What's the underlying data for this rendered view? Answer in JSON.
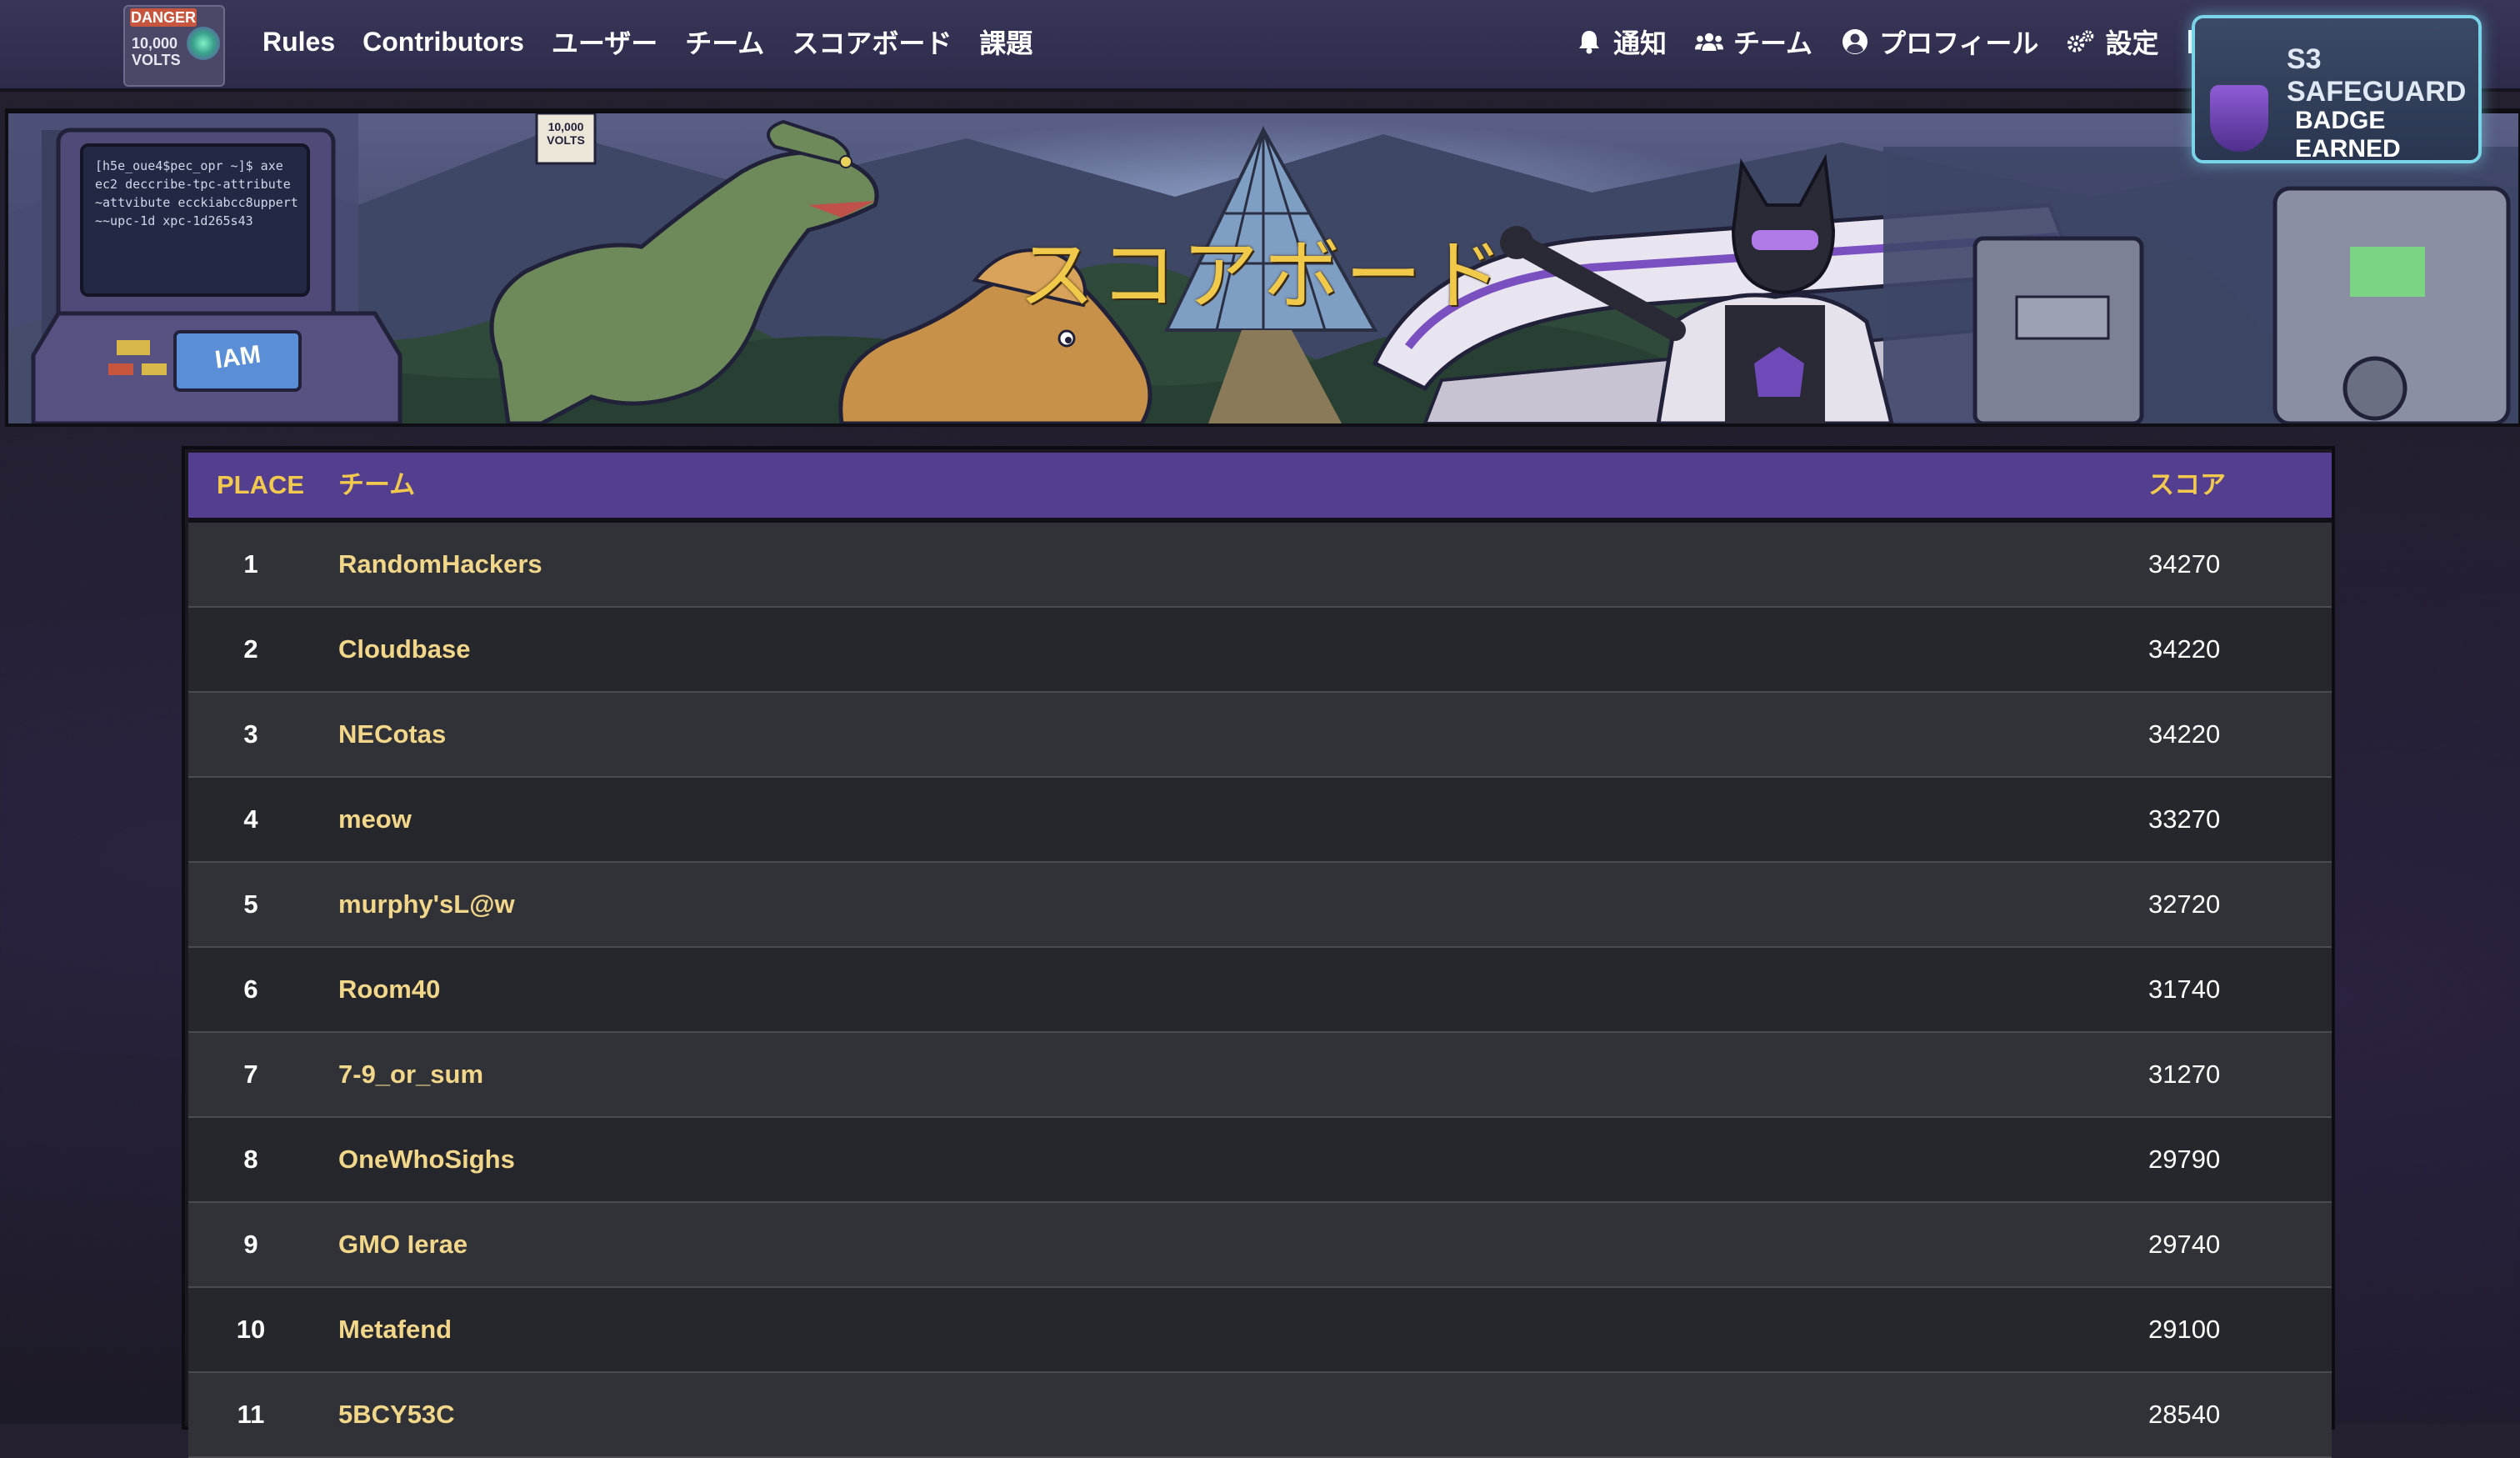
{
  "nav": {
    "logo_text_top": "DANGER",
    "logo_text_bottom": "10,000 VOLTS",
    "left_links": [
      "Rules",
      "Contributors",
      "ユーザー",
      "チーム",
      "スコアボード",
      "課題"
    ],
    "right_links": [
      {
        "label": "通知",
        "icon": "bell-icon"
      },
      {
        "label": "チーム",
        "icon": "users-icon"
      },
      {
        "label": "プロフィール",
        "icon": "user-circle-icon"
      },
      {
        "label": "設定",
        "icon": "gears-icon"
      }
    ],
    "logout_icon": "sign-out-icon",
    "language_icon": "language-icon",
    "language_glyph": "A文"
  },
  "banner": {
    "title": "スコアボード",
    "badge_line1": "S3 SAFEGUARD",
    "badge_line2": "BADGE EARNED",
    "terminal_lines": [
      "[h5e_oue4$pec_opr ~]$ axe",
      "ec2 deccribe-tpc-attribute",
      "~attvibute ecckiabcc8uppert",
      "~~upc-1d xpc-1d265s43"
    ],
    "console_label": "IAM",
    "volts_sign": "10,000 VOLTS"
  },
  "scoreboard": {
    "headers": {
      "place": "PLACE",
      "team": "チーム",
      "score": "スコア"
    },
    "rows": [
      {
        "place": "1",
        "team": "RandomHackers",
        "score": "34270"
      },
      {
        "place": "2",
        "team": "Cloudbase",
        "score": "34220"
      },
      {
        "place": "3",
        "team": "NECotas",
        "score": "34220"
      },
      {
        "place": "4",
        "team": "meow",
        "score": "33270"
      },
      {
        "place": "5",
        "team": "murphy'sL@w",
        "score": "32720"
      },
      {
        "place": "6",
        "team": "Room40",
        "score": "31740"
      },
      {
        "place": "7",
        "team": "7-9_or_sum",
        "score": "31270"
      },
      {
        "place": "8",
        "team": "OneWhoSighs",
        "score": "29790"
      },
      {
        "place": "9",
        "team": "GMO Ierae",
        "score": "29740"
      },
      {
        "place": "10",
        "team": "Metafend",
        "score": "29100"
      },
      {
        "place": "11",
        "team": "5BCY53C",
        "score": "28540"
      }
    ]
  },
  "colors": {
    "header_bg": "#533e8f",
    "header_text": "#f2c94c",
    "team_text": "#f2d68a",
    "title_gold": "#f0c84a"
  }
}
